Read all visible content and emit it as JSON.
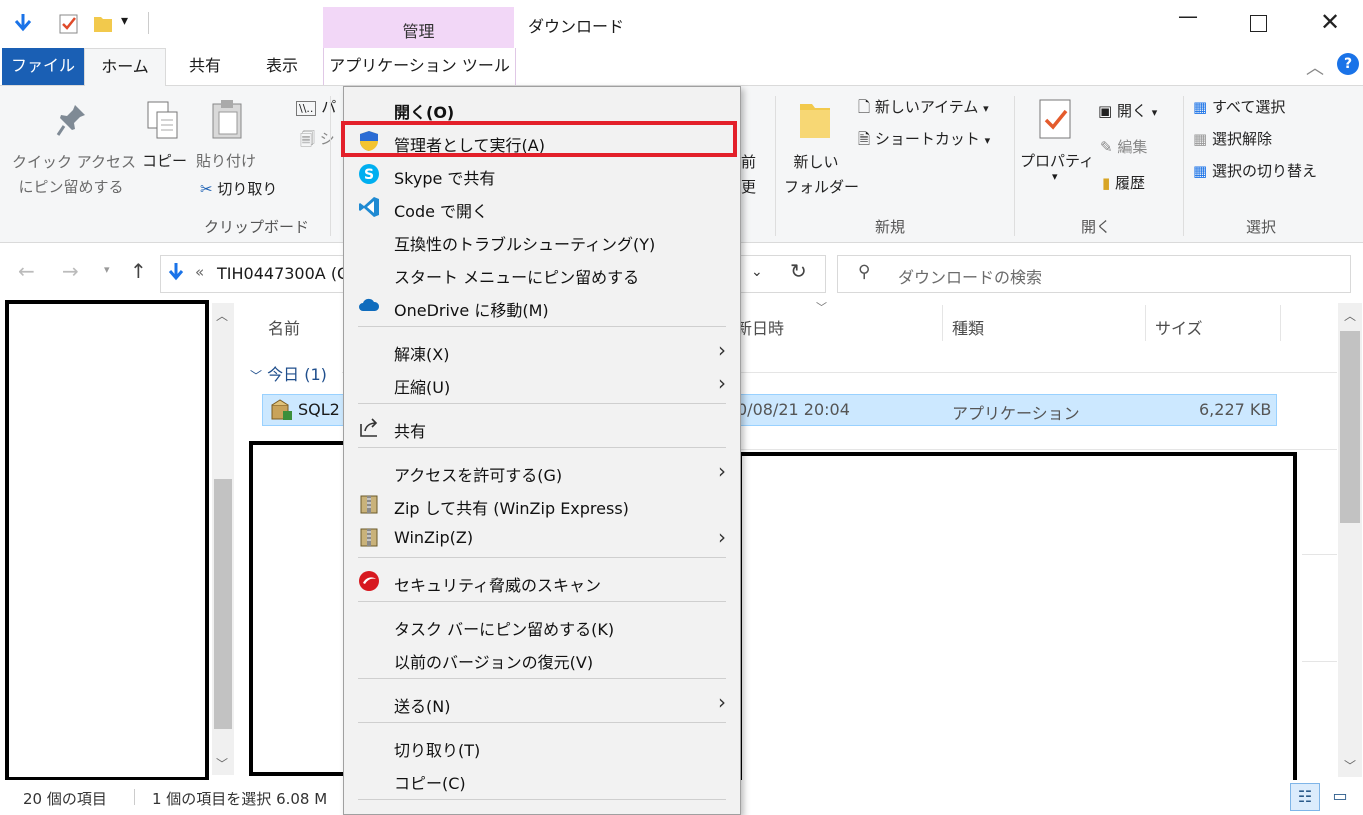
{
  "titlebar": {
    "context_tab_group": "管理",
    "window_title": "ダウンロード",
    "minimize_icon": "minimize-icon",
    "maximize_icon": "maximize-icon",
    "close_icon": "close-icon"
  },
  "tabs": {
    "file": "ファイル",
    "home": "ホーム",
    "share": "共有",
    "view": "表示",
    "app_tools": "アプリケーション ツール"
  },
  "ribbon": {
    "pin_quick_access": [
      "クイック アクセス",
      "にピン留めする"
    ],
    "copy": "コピー",
    "paste": "貼り付け",
    "cut": "切り取り",
    "copy_path_partial": "パ",
    "paste_shortcut_partial": "シ",
    "clipboard_group": "クリップボード",
    "rename_partial": [
      "前",
      "更"
    ],
    "new_folder": [
      "新しい",
      "フォルダー"
    ],
    "new_item": "新しいアイテム",
    "shortcut": "ショートカット",
    "new_group": "新規",
    "properties": "プロパティ",
    "open": "開く",
    "edit": "編集",
    "history": "履歴",
    "open_group": "開く",
    "select_all": "すべて選択",
    "select_none": "選択解除",
    "invert_selection": "選択の切り替え",
    "select_group": "選択"
  },
  "address": {
    "path_prefix": "«",
    "path": "TIH0447300A (C",
    "search_placeholder": "ダウンロードの検索"
  },
  "list": {
    "col_name": "名前",
    "col_date": "更新日時",
    "col_date_partial": "新日時",
    "col_type": "種類",
    "col_size": "サイズ",
    "group_today": "今日 (1)",
    "file_name": "SQL2",
    "file_date": "0/08/21 20:04",
    "file_type": "アプリケーション",
    "file_size": "6,227 KB"
  },
  "status": {
    "item_count": "20 個の項目",
    "selected": "1 個の項目を選択  6.08 M"
  },
  "context_menu": {
    "items": [
      {
        "label": "開く(O)",
        "bold": true
      },
      {
        "label": "管理者として実行(A)",
        "icon": "uac-shield-icon"
      },
      {
        "label": "Skype で共有",
        "icon": "skype-icon"
      },
      {
        "label": "Code で開く",
        "icon": "vscode-icon"
      },
      {
        "label": "互換性のトラブルシューティング(Y)"
      },
      {
        "label": "スタート メニューにピン留めする"
      },
      {
        "label": "OneDrive に移動(M)",
        "icon": "onedrive-icon"
      },
      {
        "label": "解凍(X)",
        "submenu": true
      },
      {
        "label": "圧縮(U)",
        "submenu": true
      },
      {
        "label": "共有",
        "icon": "share-icon"
      },
      {
        "label": "アクセスを許可する(G)",
        "submenu": true
      },
      {
        "label": "Zip して共有 (WinZip Express)",
        "icon": "winzip-icon"
      },
      {
        "label": "WinZip(Z)",
        "icon": "winzip-icon",
        "submenu": true
      },
      {
        "label": "セキュリティ脅威のスキャン",
        "icon": "trendmicro-icon"
      },
      {
        "label": "タスク バーにピン留めする(K)"
      },
      {
        "label": "以前のバージョンの復元(V)"
      },
      {
        "label": "送る(N)",
        "submenu": true
      },
      {
        "label": "切り取り(T)"
      },
      {
        "label": "コピー(C)"
      }
    ]
  },
  "colors": {
    "file_tab": "#1a5fb4",
    "context_tab": "#f2d7f7",
    "selection": "#cce8ff",
    "highlight_outline": "#e3202a"
  }
}
